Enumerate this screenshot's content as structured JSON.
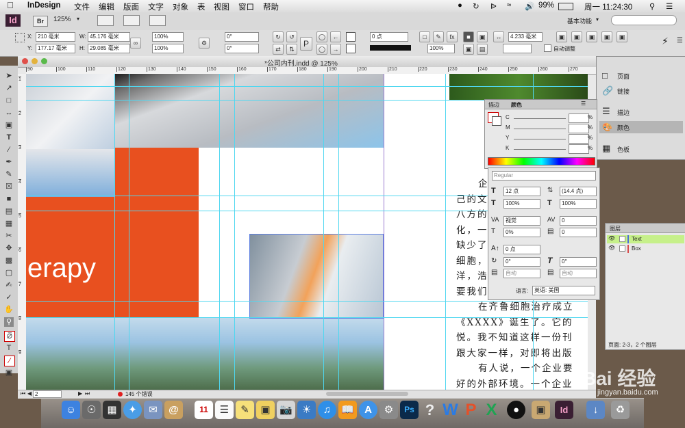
{
  "menubar": {
    "app_name": "InDesign",
    "items": [
      "文件",
      "编辑",
      "版面",
      "文字",
      "对象",
      "表",
      "视图",
      "窗口",
      "帮助"
    ],
    "battery": "99%",
    "clock": "周一 11:24:30",
    "icon_names": [
      "apple-icon",
      "wifi-icon",
      "bluetooth-icon",
      "volume-icon",
      "battery-icon",
      "search-icon",
      "list-icon"
    ]
  },
  "appbar": {
    "logo": "Id",
    "bridge": "Br",
    "zoom": "125%",
    "workspace": "基本功能",
    "search_placeholder": ""
  },
  "control": {
    "x_label": "X:",
    "x_value": "210 毫米",
    "y_label": "Y:",
    "y_value": "177.17 毫米",
    "w_label": "W:",
    "w_value": "45.176 毫米",
    "h_label": "H:",
    "h_value": "29.085 毫米",
    "scale_x": "100%",
    "scale_y": "100%",
    "angle": "0°",
    "shear": "0°",
    "stroke_weight": "0 点",
    "opacity": "100%",
    "gap": "4.233 毫米",
    "auto_fit": "自动调整"
  },
  "document": {
    "title": "*公司内刊.indd @ 125%",
    "ruler_marks": [
      "90",
      "100",
      "110",
      "120",
      "130",
      "140",
      "150",
      "160",
      "170",
      "180",
      "190",
      "200",
      "210",
      "220",
      "230",
      "240",
      "250",
      "260",
      "270"
    ],
    "vruler_marks": [
      "1",
      "2",
      "3",
      "4",
      "5",
      "6",
      "7",
      "8",
      "9"
    ],
    "erapy_text": "erapy",
    "body_lines": [
      "企",
      "己的文",
      "八方的",
      "化，一",
      "缺少了",
      "细胞，",
      "洋，浩",
      "要我们",
      "在齐鲁细胞治疗成立",
      "《XXXX》诞生了。它的",
      "悦。我不知道这样一份刊",
      "跟大家一样，对即将出版",
      "有人说，一个企业要",
      "好的外部环境。一个企业"
    ]
  },
  "status": {
    "page": "2",
    "errors": "145 个错误"
  },
  "color_panel": {
    "tab_stroke": "描边",
    "tab_color": "颜色",
    "labels": [
      "C",
      "M",
      "Y",
      "K"
    ],
    "values": [
      "",
      "",
      "",
      ""
    ],
    "unit": "%"
  },
  "char_panel": {
    "font_style": "Regular",
    "size": "12 点",
    "leading": "(14.4 点)",
    "vscale": "100%",
    "hscale": "100%",
    "kerning": "视觉",
    "tracking": "0",
    "tsume": "0%",
    "aki": "0",
    "baseline": "0 点",
    "skew": "0°",
    "rotate": "0°",
    "auto1": "自动",
    "auto2": "自动",
    "language_label": "语言:",
    "language": "英语: 美国"
  },
  "side_panel": {
    "items": [
      "页面",
      "链接",
      "描边",
      "颜色",
      "色板"
    ]
  },
  "layers_panel": {
    "title": "图层",
    "layers": [
      "Text",
      "Box"
    ],
    "status": "页面: 2-3，2 个图层"
  },
  "watermark": {
    "text": "Bai 经验",
    "url": "jingyan.baidu.com"
  },
  "dock": {
    "items": [
      "Finder",
      "Launchpad",
      "Dashboard",
      "Safari",
      "Mail",
      "Calendar",
      "Reminders",
      "Notes",
      "Stickies",
      "Preview",
      "Photos",
      "iTunes",
      "iBooks",
      "App Store",
      "System Preferences",
      "Photoshop",
      "Help",
      "Word",
      "PowerPoint",
      "Excel",
      "QQ",
      "Archive",
      "InDesign",
      "Downloads",
      "Trash"
    ],
    "cal_day": "11"
  },
  "colors": {
    "orange": "#e8501f",
    "guide": "#4fd7f0",
    "selection": "#5a7de0",
    "layer_highlight": "#c6f08a"
  }
}
